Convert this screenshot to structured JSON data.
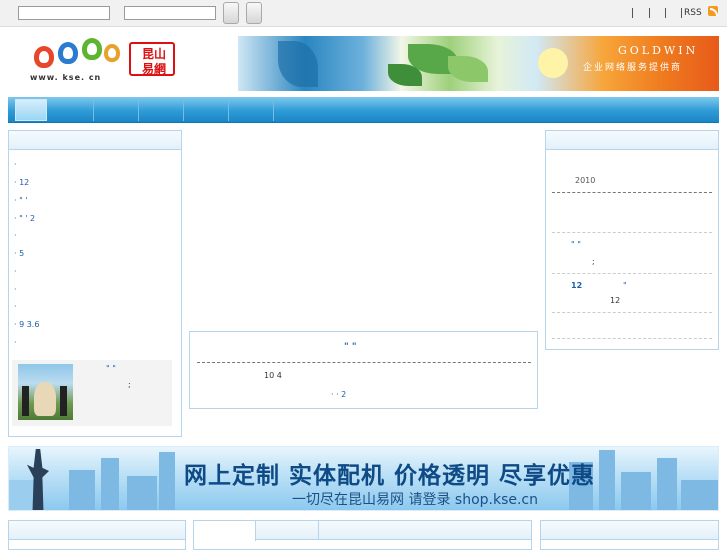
{
  "topbar": {
    "separators": [
      "|",
      "|",
      "|",
      "|"
    ],
    "rss_label": "RSS"
  },
  "header": {
    "logo_cn_line1": "昆山",
    "logo_cn_line2": "易網",
    "logo_url": "www. kse. cn",
    "banner_brand": "GOLDWIN",
    "banner_slogan": "企业网络服务提供商"
  },
  "left_list": {
    "items": [
      "·",
      "· 12",
      "·   \"   '",
      "· \" '      2",
      "·",
      "·          5",
      "·",
      "·",
      "·",
      "· 9          3.6",
      "·"
    ],
    "news_quote": "\"     \"",
    "news_semicolon": ";"
  },
  "center_box": {
    "title": "\"            \"",
    "line1": "10 4",
    "line2": "· ·           2"
  },
  "right_list": {
    "year": "2010",
    "quote": "\"     \"",
    "semicolon": ";",
    "bold_num": "12",
    "quote_close": "\"",
    "num": "12"
  },
  "ad": {
    "title": "网上定制 实体配机 价格透明 尽享优惠",
    "subtitle": "一切尽在昆山易网 请登录 shop.kse.cn"
  },
  "colors": {
    "nav_blue": "#2f9bd6",
    "link_blue": "#1f5fa8",
    "logo_red": "#d11111",
    "rss_orange": "#f39a22"
  }
}
